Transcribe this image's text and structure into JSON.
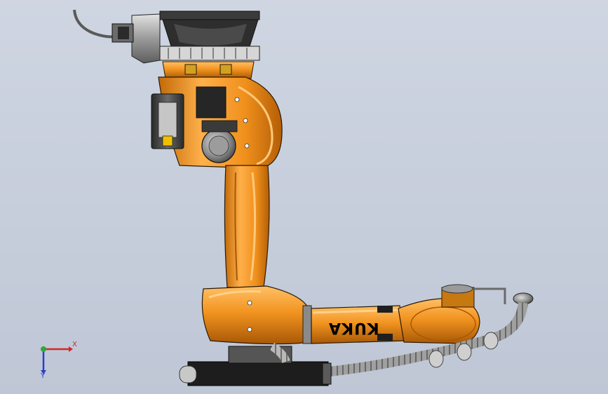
{
  "viewport": {
    "background_top": "#cfd6e2",
    "background_bottom": "#bfc7d6"
  },
  "model": {
    "kind": "industrial robot arm",
    "logo_text": "KUKA",
    "logo_rotated": true,
    "colors": {
      "body_orange": "#f0901c",
      "body_highlight": "#ffc066",
      "body_shadow": "#b35e06",
      "edge_lines": "#2a1a08",
      "motor_dark": "#3a3a3a",
      "motor_grey": "#8f8f8f",
      "cable_grey": "#a9aaa8",
      "base_black": "#1d1d1d"
    }
  },
  "triad": {
    "x_label": "X",
    "y_label": "Y",
    "x_color": "#d4262b",
    "y_color": "#2c3ec8",
    "z_color": "#2fa83a"
  }
}
